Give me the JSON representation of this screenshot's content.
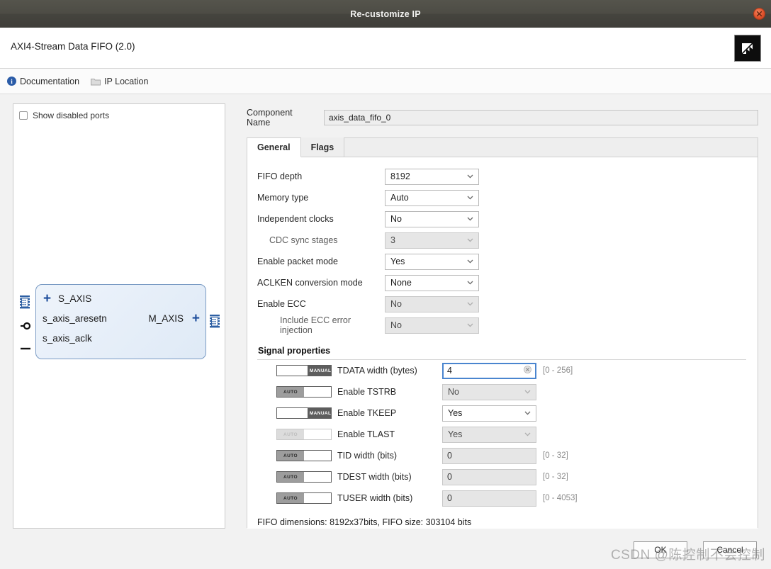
{
  "window": {
    "title": "Re-customize IP",
    "close_icon": "close-icon"
  },
  "ip_header": {
    "title": "AXI4-Stream Data FIFO (2.0)",
    "logo_icon": "xilinx-logo-icon"
  },
  "toolbar": {
    "items": [
      {
        "label": "Documentation",
        "icon": "info-icon"
      },
      {
        "label": "IP Location",
        "icon": "folder-icon"
      }
    ]
  },
  "ports_panel": {
    "show_disabled_ports_label": "Show disabled ports",
    "show_disabled_ports_checked": false,
    "block": {
      "left_ports": [
        {
          "label": "S_AXIS",
          "type": "bus",
          "expandable": true
        },
        {
          "label": "s_axis_aresetn",
          "type": "active-low-pin"
        },
        {
          "label": "s_axis_aclk",
          "type": "clock-pin"
        }
      ],
      "right_ports": [
        {
          "label": "M_AXIS",
          "type": "bus",
          "expandable": true
        }
      ]
    }
  },
  "component": {
    "label": "Component Name",
    "value": "axis_data_fifo_0"
  },
  "tabs": [
    {
      "label": "General",
      "active": true
    },
    {
      "label": "Flags",
      "active": false
    }
  ],
  "general": {
    "rows": [
      {
        "label": "FIFO depth",
        "value": "8192",
        "disabled": false,
        "indent": 0
      },
      {
        "label": "Memory type",
        "value": "Auto",
        "disabled": false,
        "indent": 0
      },
      {
        "label": "Independent clocks",
        "value": "No",
        "disabled": false,
        "indent": 0
      },
      {
        "label": "CDC sync stages",
        "value": "3",
        "disabled": true,
        "indent": 1
      },
      {
        "label": "Enable packet mode",
        "value": "Yes",
        "disabled": false,
        "indent": 0
      },
      {
        "label": "ACLKEN conversion mode",
        "value": "None",
        "disabled": false,
        "indent": 0
      },
      {
        "label": "Enable ECC",
        "value": "No",
        "disabled": true,
        "indent": 0
      },
      {
        "label": "Include ECC error injection",
        "value": "No",
        "disabled": true,
        "indent": 1
      }
    ]
  },
  "signal_properties": {
    "title": "Signal properties",
    "rows": [
      {
        "toggle_mode": "MANUAL",
        "toggle_disabled": false,
        "label": "TDATA width (bytes)",
        "control": "text",
        "value": "4",
        "focused": true,
        "clearable": true,
        "disabled": false,
        "hint": "[0 - 256]"
      },
      {
        "toggle_mode": "AUTO",
        "toggle_disabled": false,
        "label": "Enable TSTRB",
        "control": "select",
        "value": "No",
        "focused": false,
        "clearable": false,
        "disabled": true,
        "hint": ""
      },
      {
        "toggle_mode": "MANUAL",
        "toggle_disabled": false,
        "label": "Enable TKEEP",
        "control": "select",
        "value": "Yes",
        "focused": false,
        "clearable": false,
        "disabled": false,
        "hint": ""
      },
      {
        "toggle_mode": "AUTO",
        "toggle_disabled": true,
        "label": "Enable TLAST",
        "control": "select",
        "value": "Yes",
        "focused": false,
        "clearable": false,
        "disabled": true,
        "hint": ""
      },
      {
        "toggle_mode": "AUTO",
        "toggle_disabled": false,
        "label": "TID width (bits)",
        "control": "text",
        "value": "0",
        "focused": false,
        "clearable": false,
        "disabled": true,
        "hint": "[0 - 32]"
      },
      {
        "toggle_mode": "AUTO",
        "toggle_disabled": false,
        "label": "TDEST width (bits)",
        "control": "text",
        "value": "0",
        "focused": false,
        "clearable": false,
        "disabled": true,
        "hint": "[0 - 32]"
      },
      {
        "toggle_mode": "AUTO",
        "toggle_disabled": false,
        "label": "TUSER width (bits)",
        "control": "text",
        "value": "0",
        "focused": false,
        "clearable": false,
        "disabled": true,
        "hint": "[0 - 4053]"
      }
    ],
    "fifo_dimensions": "FIFO dimensions: 8192x37bits, FIFO size: 303104 bits"
  },
  "footer": {
    "ok_label": "OK",
    "cancel_label": "Cancel"
  },
  "watermark": {
    "text": "CSDN @陈控制不会控制"
  },
  "colors": {
    "titlebar": "#4d4c45",
    "close": "#e0522c",
    "accent_blue": "#1f4e9c",
    "focus_blue": "#4a85cf",
    "block_fill": "#e7eff9",
    "block_border": "#7a9bc4"
  }
}
